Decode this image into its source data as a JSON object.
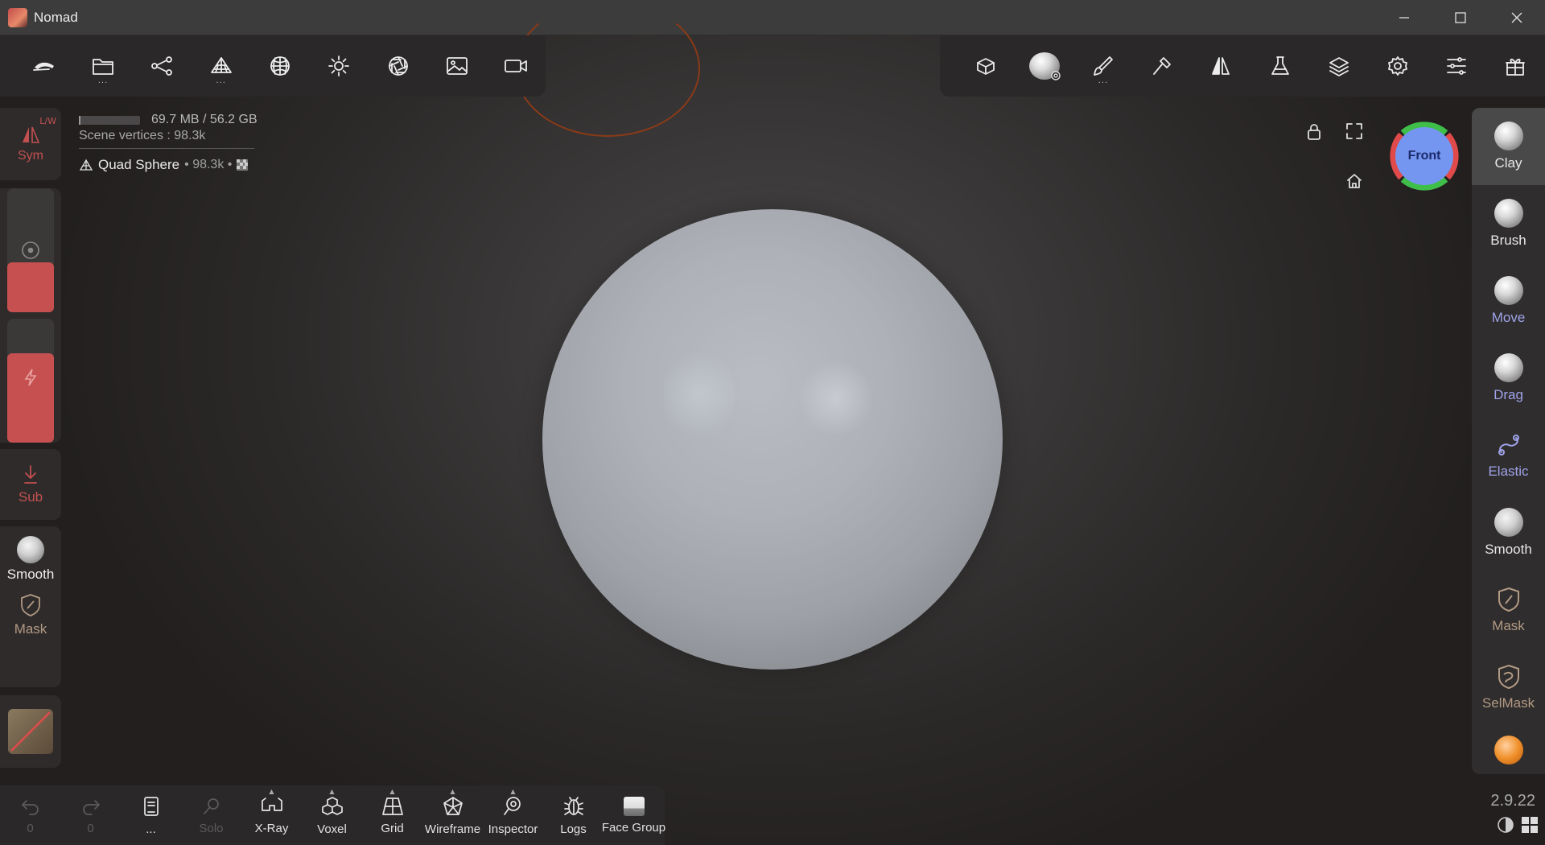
{
  "window": {
    "title": "Nomad"
  },
  "colors": {
    "accent_red": "#c65050",
    "panel_bg": "#2a2828",
    "gizmo_x": "#e04a4a",
    "gizmo_y": "#3fbf4a",
    "gizmo_z": "#7596f0"
  },
  "top_left_toolbar": {
    "items": [
      {
        "name": "nomad-menu-icon"
      },
      {
        "name": "folder-icon",
        "has_more": true
      },
      {
        "name": "scene-graph-icon"
      },
      {
        "name": "topology-icon",
        "has_more": true
      },
      {
        "name": "material-sphere-icon"
      },
      {
        "name": "light-icon"
      },
      {
        "name": "shading-aperture-icon"
      },
      {
        "name": "background-image-icon"
      },
      {
        "name": "camera-icon"
      }
    ],
    "more_indicator": "..."
  },
  "top_right_toolbar": {
    "items": [
      {
        "name": "render-box-icon"
      },
      {
        "name": "matcap-ball-icon"
      },
      {
        "name": "paint-brush-icon",
        "has_more": true
      },
      {
        "name": "stroke-hammer-icon"
      },
      {
        "name": "symmetry-icon"
      },
      {
        "name": "flask-icon"
      },
      {
        "name": "layers-icon"
      },
      {
        "name": "settings-icon"
      },
      {
        "name": "sliders-icon"
      },
      {
        "name": "gift-icon"
      }
    ],
    "more_indicator": "..."
  },
  "info": {
    "memory": "69.7 MB / 56.2 GB",
    "memory_used_fraction": 0.0012,
    "scene_vertices": "Scene vertices : 98.3k",
    "mesh_name": "Quad Sphere",
    "mesh_count": "• 98.3k •"
  },
  "view": {
    "gizmo_label": "Front"
  },
  "left_panel": {
    "sym_label": "Sym",
    "lw_label": "L/W",
    "radius_fraction": 0.5,
    "intensity_fraction": 0.72,
    "sub_label": "Sub",
    "smooth_label": "Smooth",
    "mask_label": "Mask"
  },
  "right_panel": {
    "tools": [
      {
        "label": "Clay",
        "active": true,
        "color": "#e8e8e8"
      },
      {
        "label": "Brush",
        "active": false,
        "color": "#e8e8e8"
      },
      {
        "label": "Move",
        "active": false,
        "color": "#9fa3ea"
      },
      {
        "label": "Drag",
        "active": false,
        "color": "#9fa3ea"
      },
      {
        "label": "Elastic",
        "active": false,
        "color": "#9fa3ea"
      },
      {
        "label": "Smooth",
        "active": false,
        "color": "#e8e8e8"
      },
      {
        "label": "Mask",
        "active": false,
        "color": "#b29a84"
      },
      {
        "label": "SelMask",
        "active": false,
        "color": "#b29a84"
      }
    ]
  },
  "bottom_toolbar": {
    "undo_count": "0",
    "redo_count": "0",
    "notes_label": "...",
    "solo_label": "Solo",
    "xray_label": "X-Ray",
    "voxel_label": "Voxel",
    "grid_label": "Grid",
    "wireframe_label": "Wireframe",
    "inspector_label": "Inspector",
    "logs_label": "Logs",
    "face_group_label": "Face Group"
  },
  "version": "2.9.22"
}
